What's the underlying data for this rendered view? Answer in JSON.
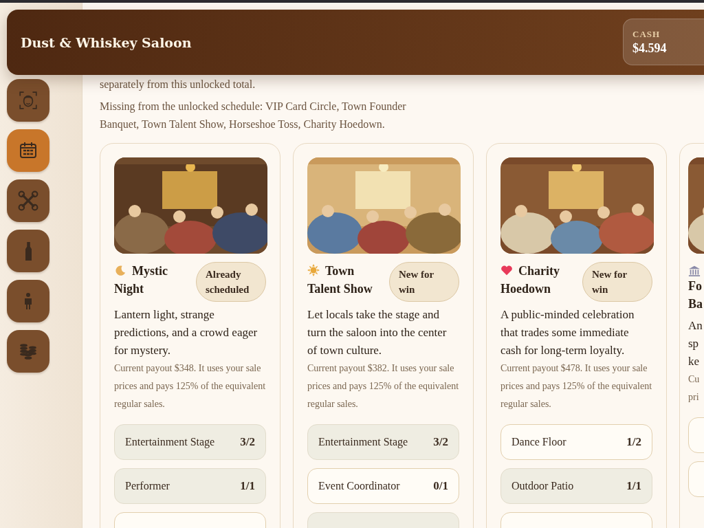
{
  "header": {
    "title": "Dust & Whiskey Saloon",
    "cash": {
      "label": "CASH",
      "value": "$4.594"
    }
  },
  "sidebar": {
    "items": [
      {
        "selected": false
      },
      {
        "selected": true
      },
      {
        "selected": false
      },
      {
        "selected": false
      },
      {
        "selected": false
      },
      {
        "selected": false
      }
    ]
  },
  "intro": "separately from this unlocked total.",
  "missing": "Missing from the unlocked schedule: VIP Card Circle, Town Founder Banquet, Town Talent Show, Horseshoe Toss, Charity Hoedown.",
  "events": [
    {
      "kind": "full",
      "title": "Mystic Night",
      "badge": "Already scheduled",
      "description": "Lantern light, strange predictions, and a crowd eager for mystery.",
      "note": "Current payout $348. It uses your sale prices and pays 125% of the equivalent regular sales.",
      "requirements": [
        {
          "label": "Entertainment Stage",
          "count": "3/2",
          "met": true
        },
        {
          "label": "Performer",
          "count": "1/1",
          "met": true
        },
        {
          "met": false
        }
      ]
    },
    {
      "kind": "full",
      "title": "Town Talent Show",
      "badge": "New for win",
      "description": "Let locals take the stage and turn the saloon into the center of town culture.",
      "note": "Current payout $382. It uses your sale prices and pays 125% of the equivalent regular sales.",
      "requirements": [
        {
          "label": "Entertainment Stage",
          "count": "3/2",
          "met": true
        },
        {
          "label": "Event Coordinator",
          "count": "0/1",
          "met": false
        },
        {
          "met": true
        }
      ]
    },
    {
      "kind": "full",
      "title": "Charity Hoedown",
      "badge": "New for win",
      "description": "A public-minded celebration that trades some immediate cash for long-term loyalty.",
      "note": "Current payout $478. It uses your sale prices and pays 125% of the equivalent regular sales.",
      "requirements": [
        {
          "label": "Dance Floor",
          "count": "1/2",
          "met": false
        },
        {
          "label": "Outdoor Patio",
          "count": "1/1",
          "met": true
        },
        {
          "met": false
        }
      ]
    },
    {
      "kind": "partial",
      "title_lines": [
        "Fo",
        "Ba"
      ],
      "description_lines": [
        "An",
        "sp",
        "ke"
      ],
      "note_lines": [
        "Cu",
        "pri"
      ],
      "requirements": [
        {
          "met": false
        },
        {
          "met": false
        }
      ]
    }
  ]
}
